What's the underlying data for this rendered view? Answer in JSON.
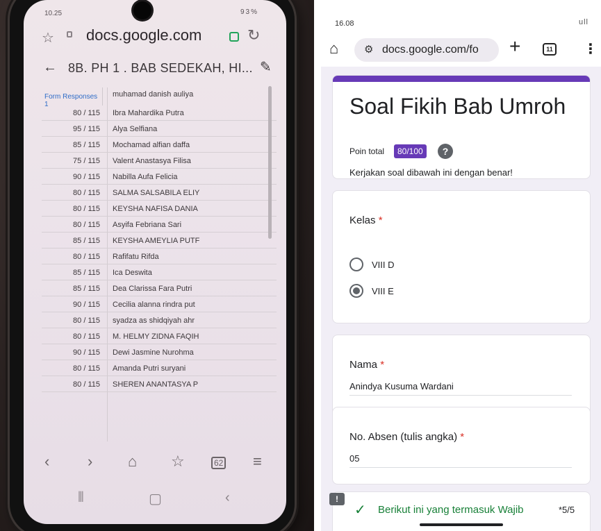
{
  "phone_photo": {
    "status_time": "10.25",
    "status_right": "93%",
    "url": "docs.google.com",
    "doc_title": "8B. PH 1 . BAB SEDEKAH, HI...",
    "sheet_tab": "Form Responses 1",
    "first_row_name": "muhamad danish auliya",
    "rows": [
      {
        "score": "80 / 115",
        "name": "Ibra Mahardika Putra"
      },
      {
        "score": "95 / 115",
        "name": "Alya Selfiana"
      },
      {
        "score": "85 / 115",
        "name": "Mochamad alfian daffa"
      },
      {
        "score": "75 / 115",
        "name": "Valent Anastasya Filisa"
      },
      {
        "score": "90 / 115",
        "name": "Nabilla Aufa Felicia"
      },
      {
        "score": "80 / 115",
        "name": "SALMA SALSABILA ELIY"
      },
      {
        "score": "80 / 115",
        "name": "KEYSHA NAFISA DANIA"
      },
      {
        "score": "80 / 115",
        "name": "Asyifa Febriana Sari"
      },
      {
        "score": "85 / 115",
        "name": "KEYSHA AMEYLIA PUTF"
      },
      {
        "score": "80 / 115",
        "name": "Rafifatu Rifda"
      },
      {
        "score": "85 / 115",
        "name": "Ica Deswita"
      },
      {
        "score": "85 / 115",
        "name": "Dea Clarissa Fara Putri"
      },
      {
        "score": "90 / 115",
        "name": "Cecilia alanna rindra put"
      },
      {
        "score": "80 / 115",
        "name": "syadza as shidqiyah ahr"
      },
      {
        "score": "80 / 115",
        "name": "M. HELMY ZIDNA FAQIH"
      },
      {
        "score": "90 / 115",
        "name": "Dewi Jasmine Nurohma"
      },
      {
        "score": "80 / 115",
        "name": "Amanda Putri suryani"
      },
      {
        "score": "80 / 115",
        "name": "SHEREN ANANTASYA P"
      }
    ],
    "nav_tab_count": "62"
  },
  "form_screen": {
    "status_time": "16.08",
    "status_right": "ull",
    "url": "docs.google.com/fo",
    "tab_count": "11",
    "title": "Soal Fikih Bab Umroh",
    "poin_label": "Poin total",
    "poin_value": "80/100",
    "help_glyph": "?",
    "description": "Kerjakan soal dibawah ini dengan benar!",
    "q_kelas": {
      "label": "Kelas",
      "required": "*",
      "options": [
        {
          "label": "VIII D",
          "selected": false
        },
        {
          "label": "VIII E",
          "selected": true
        }
      ]
    },
    "q_nama": {
      "label": "Nama",
      "required": "*",
      "answer": "Anindya Kusuma Wardani"
    },
    "q_absen": {
      "label": "No. Absen (tulis angka)",
      "required": "*",
      "answer": "05"
    },
    "q_wajib": {
      "label": "Berikut ini yang termasuk Wajib",
      "score": "*5/5"
    },
    "colors": {
      "accent": "#673ab7",
      "required": "#d93025",
      "correct": "#188038"
    }
  }
}
